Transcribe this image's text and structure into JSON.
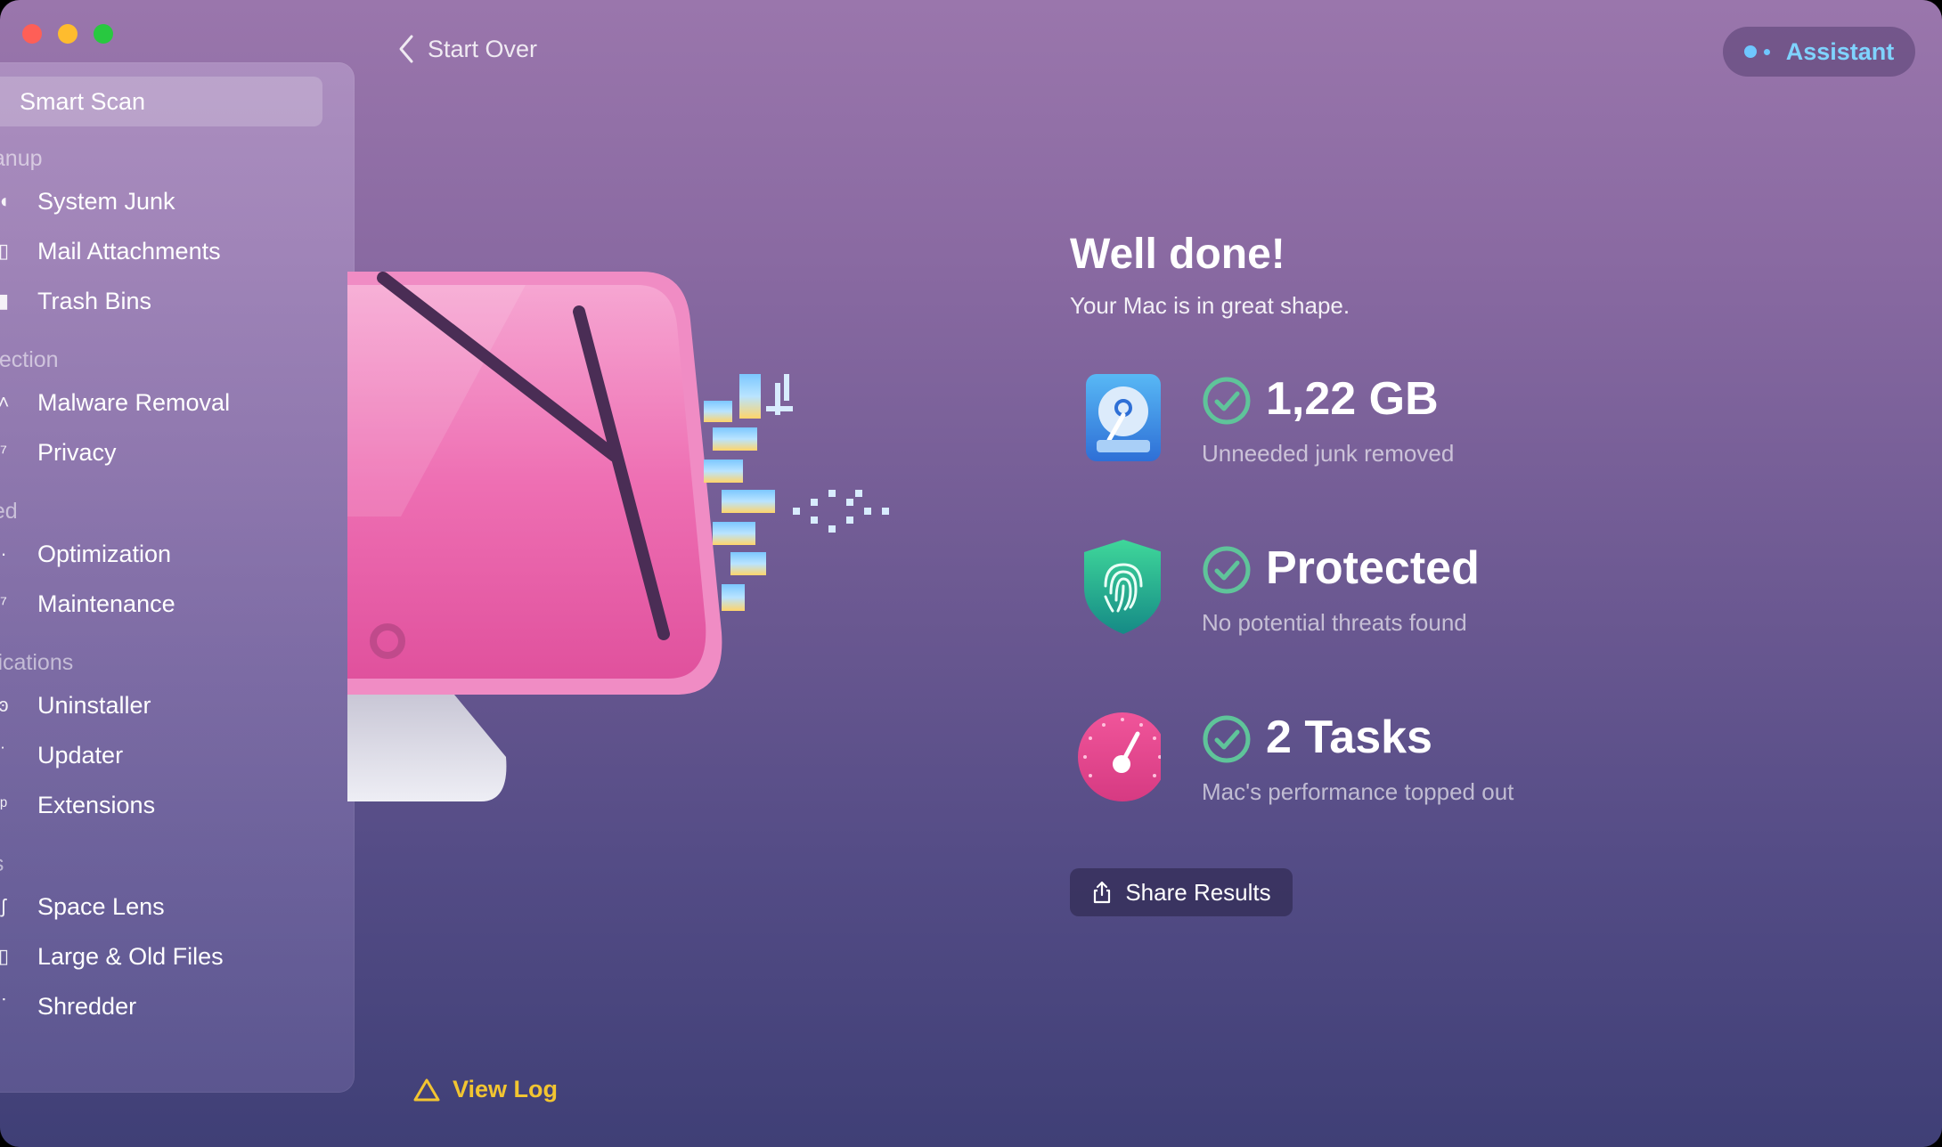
{
  "window": {
    "traffic_lights": [
      "close",
      "minimize",
      "zoom"
    ]
  },
  "header": {
    "back_label": "Start Over",
    "assistant_label": "Assistant",
    "accent": "#7fd3ff"
  },
  "sidebar": {
    "active": "Smart Scan",
    "items": [
      {
        "label": "Smart Scan",
        "icon": "smart-scan-icon"
      },
      {
        "section": "eanup"
      },
      {
        "label": "System Junk",
        "icon": "system-junk-icon"
      },
      {
        "label": "Mail Attachments",
        "icon": "mail-icon"
      },
      {
        "label": "Trash Bins",
        "icon": "trash-icon"
      },
      {
        "section": "otection"
      },
      {
        "label": "Malware Removal",
        "icon": "malware-icon"
      },
      {
        "label": "Privacy",
        "icon": "privacy-icon"
      },
      {
        "section": "eed"
      },
      {
        "label": "Optimization",
        "icon": "optimization-icon"
      },
      {
        "label": "Maintenance",
        "icon": "maintenance-icon"
      },
      {
        "section": "plications"
      },
      {
        "label": "Uninstaller",
        "icon": "uninstaller-icon"
      },
      {
        "label": "Updater",
        "icon": "updater-icon"
      },
      {
        "label": "Extensions",
        "icon": "extensions-icon"
      },
      {
        "section": "es"
      },
      {
        "label": "Space Lens",
        "icon": "space-lens-icon"
      },
      {
        "label": "Large & Old Files",
        "icon": "files-icon"
      },
      {
        "label": "Shredder",
        "icon": "shredder-icon"
      }
    ]
  },
  "main": {
    "title": "Well done!",
    "subtitle": "Your Mac is in great shape.",
    "results": [
      {
        "value": "1,22 GB",
        "desc": "Unneeded junk removed",
        "icon": "hard-drive-icon"
      },
      {
        "value": "Protected",
        "desc": "No potential threats found",
        "icon": "fingerprint-shield-icon"
      },
      {
        "value": "2 Tasks",
        "desc": "Mac's performance topped out",
        "icon": "speedometer-icon"
      }
    ],
    "share_label": "Share Results",
    "view_log_label": "View Log",
    "check_color": "#5fc49a",
    "warning_color": "#f2c531"
  }
}
